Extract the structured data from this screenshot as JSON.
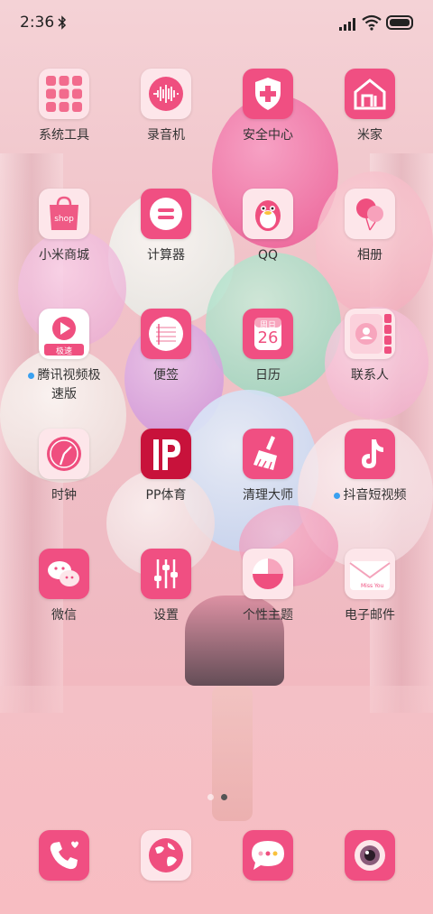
{
  "status": {
    "time": "2:36"
  },
  "apps": [
    {
      "label": "系统工具"
    },
    {
      "label": "录音机"
    },
    {
      "label": "安全中心"
    },
    {
      "label": "米家"
    },
    {
      "label": "小米商城",
      "icon_text": "shop"
    },
    {
      "label": "计算器"
    },
    {
      "label": "QQ"
    },
    {
      "label": "相册"
    },
    {
      "label_line1": "腾讯视频极",
      "label_line2": "速版",
      "icon_text": "极速",
      "dot": true
    },
    {
      "label": "便签"
    },
    {
      "label": "日历",
      "icon_top": "周日",
      "icon_day": "26"
    },
    {
      "label": "联系人",
      "tabs": [
        "a",
        "b",
        "c",
        "d"
      ]
    },
    {
      "label": "时钟"
    },
    {
      "label": "PP体育"
    },
    {
      "label": "清理大师"
    },
    {
      "label": "抖音短视频",
      "dot": true
    },
    {
      "label": "微信"
    },
    {
      "label": "设置"
    },
    {
      "label": "个性主题"
    },
    {
      "label": "电子邮件",
      "icon_text": "Miss You"
    }
  ],
  "dock": [
    "phone-icon",
    "browser-icon",
    "messages-icon",
    "camera-icon"
  ],
  "pager": {
    "pages": 2,
    "current": 2
  },
  "colors": {
    "accent": "#ef5a85",
    "icon_light": "#fde6ea"
  }
}
